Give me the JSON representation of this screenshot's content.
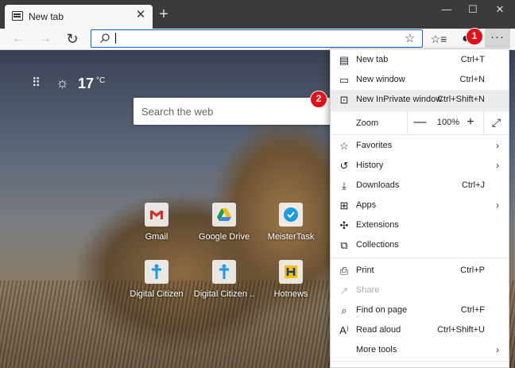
{
  "tab": {
    "title": "New tab",
    "close": "✕"
  },
  "toolbar": {
    "back": "←",
    "forward": "→",
    "refresh": "↻",
    "address_value": "",
    "favorite": "☆",
    "collections": "☆≡",
    "profile": "●",
    "more": "···"
  },
  "window": {
    "minimize": "—",
    "maximize": "☐",
    "close": "✕",
    "new_tab": "+"
  },
  "page": {
    "temperature": "17",
    "temp_unit": "°C",
    "search_placeholder": "Search the web",
    "quick_links": [
      {
        "label": "Gmail",
        "icon": "gmail-icon"
      },
      {
        "label": "Google Drive",
        "icon": "google-drive-icon"
      },
      {
        "label": "MeisterTask",
        "icon": "meistertask-icon"
      },
      {
        "label": "Digital Citizen",
        "icon": "digital-citizen-icon"
      },
      {
        "label": "Digital Citizen ..",
        "icon": "digital-citizen-icon"
      },
      {
        "label": "Hotnews",
        "icon": "hotnews-icon"
      }
    ]
  },
  "menu": {
    "new_tab": {
      "label": "New tab",
      "shortcut": "Ctrl+T"
    },
    "new_window": {
      "label": "New window",
      "shortcut": "Ctrl+N"
    },
    "new_inprivate": {
      "label": "New InPrivate window",
      "shortcut": "Ctrl+Shift+N"
    },
    "zoom": {
      "label": "Zoom",
      "value": "100%",
      "minus": "—",
      "plus": "+"
    },
    "favorites": {
      "label": "Favorites"
    },
    "history": {
      "label": "History"
    },
    "downloads": {
      "label": "Downloads",
      "shortcut": "Ctrl+J"
    },
    "apps": {
      "label": "Apps"
    },
    "extensions": {
      "label": "Extensions"
    },
    "collections": {
      "label": "Collections"
    },
    "print": {
      "label": "Print",
      "shortcut": "Ctrl+P"
    },
    "share": {
      "label": "Share"
    },
    "find": {
      "label": "Find on page",
      "shortcut": "Ctrl+F"
    },
    "read_aloud": {
      "label": "Read aloud",
      "shortcut": "Ctrl+Shift+U"
    },
    "more_tools": {
      "label": "More tools"
    }
  },
  "annotations": {
    "step1": "1",
    "step2": "2"
  },
  "colors": {
    "accent": "#0a64c8",
    "badge": "#e3101a"
  }
}
